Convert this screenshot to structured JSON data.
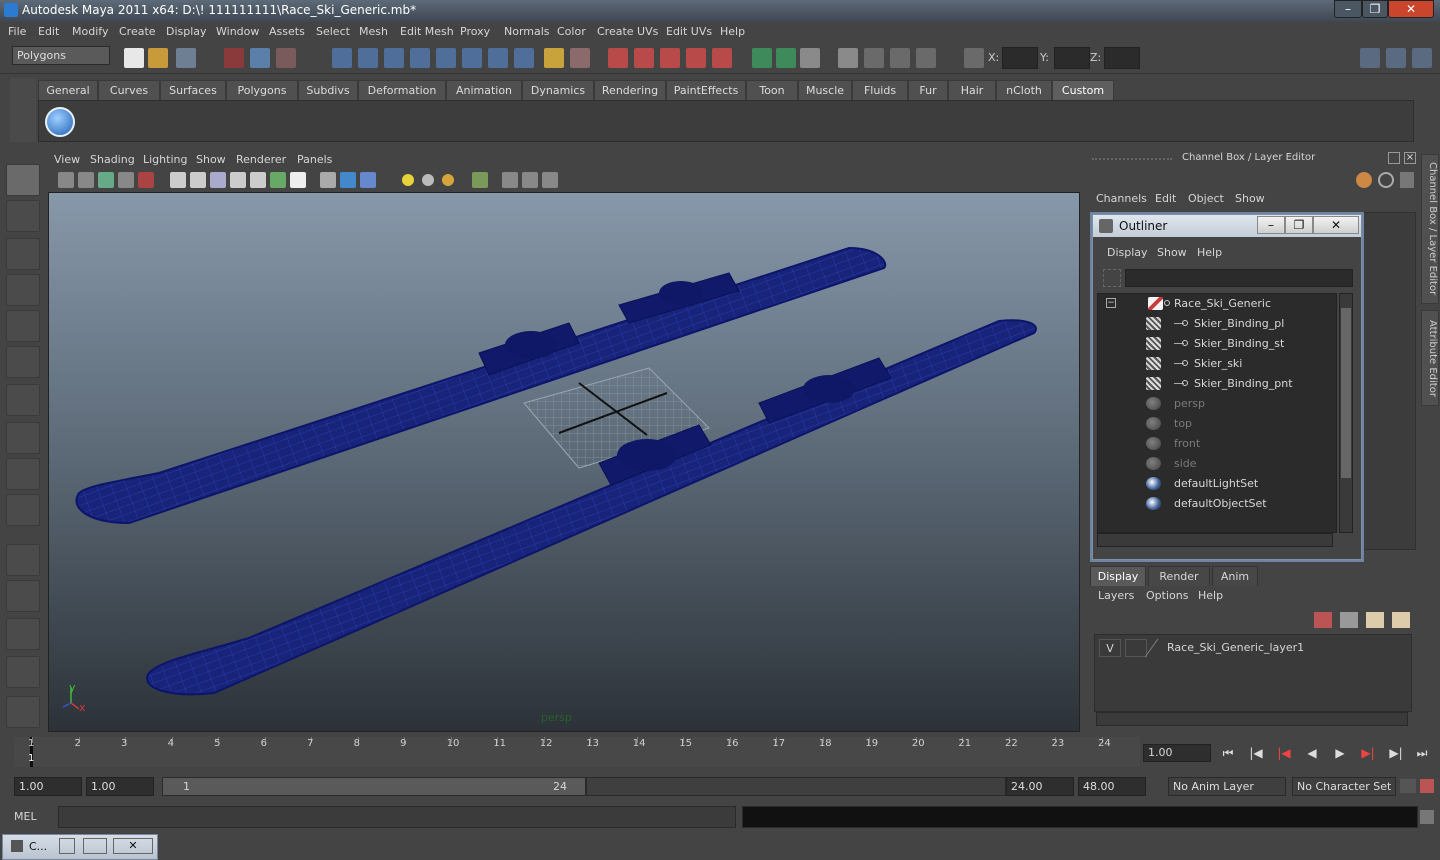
{
  "window": {
    "title": "Autodesk Maya 2011 x64: D:\\! 111111111\\Race_Ski_Generic.mb*",
    "minimize": "–",
    "maximize": "❐",
    "close": "✕"
  },
  "menubar": [
    "File",
    "Edit",
    "Modify",
    "Create",
    "Display",
    "Window",
    "Assets",
    "Select",
    "Mesh",
    "Edit Mesh",
    "Proxy",
    "Normals",
    "Color",
    "Create UVs",
    "Edit UVs",
    "Help"
  ],
  "statusline": {
    "mode": "Polygons",
    "x_label": "X:",
    "y_label": "Y:",
    "z_label": "Z:"
  },
  "shelf": {
    "tabs": [
      "General",
      "Curves",
      "Surfaces",
      "Polygons",
      "Subdivs",
      "Deformation",
      "Animation",
      "Dynamics",
      "Rendering",
      "PaintEffects",
      "Toon",
      "Muscle",
      "Fluids",
      "Fur",
      "Hair",
      "nCloth",
      "Custom"
    ],
    "active_tab": "Custom"
  },
  "viewport": {
    "menu": [
      "View",
      "Shading",
      "Lighting",
      "Show",
      "Renderer",
      "Panels"
    ],
    "camera": "persp",
    "axis_y": "y",
    "axis_x": "x",
    "wire_color": "#1a2a8a"
  },
  "channelbox": {
    "title": "Channel Box / Layer Editor",
    "menu": [
      "Channels",
      "Edit",
      "Object",
      "Show"
    ]
  },
  "side_tabs": [
    "Channel Box / Layer Editor",
    "Attribute Editor"
  ],
  "outliner": {
    "title": "Outliner",
    "menu": [
      "Display",
      "Show",
      "Help"
    ],
    "items": [
      {
        "label": "Race_Ski_Generic",
        "kind": "root"
      },
      {
        "label": "Skier_Binding_pl",
        "kind": "mesh"
      },
      {
        "label": "Skier_Binding_st",
        "kind": "mesh"
      },
      {
        "label": "Skier_ski",
        "kind": "mesh"
      },
      {
        "label": "Skier_Binding_pnt",
        "kind": "mesh"
      },
      {
        "label": "persp",
        "kind": "camera"
      },
      {
        "label": "top",
        "kind": "camera"
      },
      {
        "label": "front",
        "kind": "camera"
      },
      {
        "label": "side",
        "kind": "camera"
      },
      {
        "label": "defaultLightSet",
        "kind": "set"
      },
      {
        "label": "defaultObjectSet",
        "kind": "set"
      }
    ]
  },
  "layer_editor": {
    "tabs": [
      "Display",
      "Render",
      "Anim"
    ],
    "active_tab": "Display",
    "menu": [
      "Layers",
      "Options",
      "Help"
    ],
    "layers": [
      {
        "visible": "V",
        "name": "Race_Ski_Generic_layer1"
      }
    ]
  },
  "timeline": {
    "frames": [
      "1",
      "2",
      "3",
      "4",
      "5",
      "6",
      "7",
      "8",
      "9",
      "10",
      "11",
      "12",
      "13",
      "14",
      "15",
      "16",
      "17",
      "18",
      "19",
      "20",
      "21",
      "22",
      "23",
      "24"
    ],
    "current_frame_marker": "1",
    "current_frame": "1.00"
  },
  "range": {
    "start_time": "1.00",
    "playback_start": "1.00",
    "range_start": "1",
    "range_end": "24",
    "playback_end": "24.00",
    "end_time": "48.00",
    "anim_layer": "No Anim Layer",
    "character_set": "No Character Set"
  },
  "commandline": {
    "label": "MEL"
  },
  "minimized": {
    "label": "C..."
  }
}
